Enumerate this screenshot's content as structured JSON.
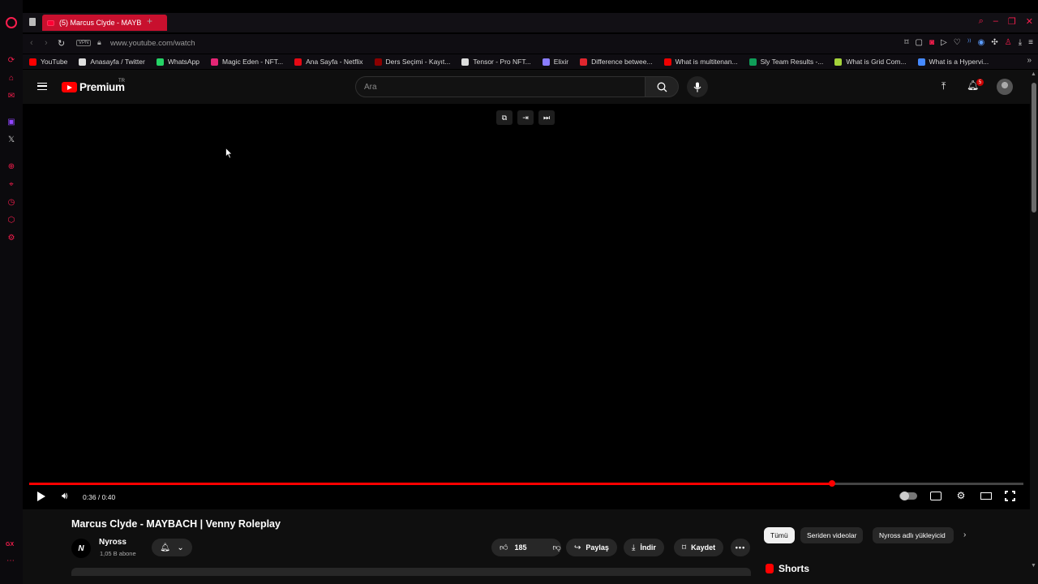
{
  "browser": {
    "tab": {
      "title": "(5) Marcus Clyde - MAYB"
    },
    "address": {
      "vpn_label": "VPN",
      "url": "www.youtube.com/watch"
    },
    "bookmarks": [
      {
        "label": "YouTube",
        "icon": "youtube-icon",
        "color": "#ff0000"
      },
      {
        "label": "Anasayfa / Twitter",
        "icon": "x-icon",
        "color": "#dddddd"
      },
      {
        "label": "WhatsApp",
        "icon": "whatsapp-icon",
        "color": "#25d366"
      },
      {
        "label": "Magic Eden - NFT...",
        "icon": "magic-eden-icon",
        "color": "#e42575"
      },
      {
        "label": "Ana Sayfa - Netflix",
        "icon": "netflix-icon",
        "color": "#e50914"
      },
      {
        "label": "Ders Seçimi - Kayıt...",
        "icon": "school-icon",
        "color": "#8b0000"
      },
      {
        "label": "Tensor - Pro NFT...",
        "icon": "tensor-icon",
        "color": "#dddddd"
      },
      {
        "label": "Elixir",
        "icon": "elixir-icon",
        "color": "#8a7dff"
      },
      {
        "label": "Difference betwee...",
        "icon": "triangle-icon",
        "color": "#e0262e"
      },
      {
        "label": "What is multitenan...",
        "icon": "redhat-icon",
        "color": "#ee0000"
      },
      {
        "label": "Sly Team Results -...",
        "icon": "sheets-icon",
        "color": "#0f9d58"
      },
      {
        "label": "What is Grid Com...",
        "icon": "h-icon",
        "color": "#a4d33a"
      },
      {
        "label": "What is a Hypervi...",
        "icon": "ibm-icon",
        "color": "#4589ff"
      }
    ]
  },
  "youtube": {
    "brand": "Premium",
    "region": "TR",
    "search": {
      "placeholder": "Ara"
    },
    "notifications": "5",
    "player": {
      "time": "0:36 / 0:40",
      "current_seconds": 36,
      "duration_seconds": 40
    },
    "video": {
      "title": "Marcus Clyde - MAYBACH | Venny Roleplay",
      "channel_initial": "N",
      "channel_name": "Nyross",
      "subscribers": "1,05 B abone",
      "likes": "185",
      "share_label": "Paylaş",
      "download_label": "İndir",
      "save_label": "Kaydet"
    },
    "chips": [
      "Tümü",
      "Seriden videolar",
      "Nyross adlı yükleyicid"
    ],
    "shorts_label": "Shorts"
  },
  "colors": {
    "accent": "#fa1e4e",
    "youtube_red": "#ff0000"
  }
}
